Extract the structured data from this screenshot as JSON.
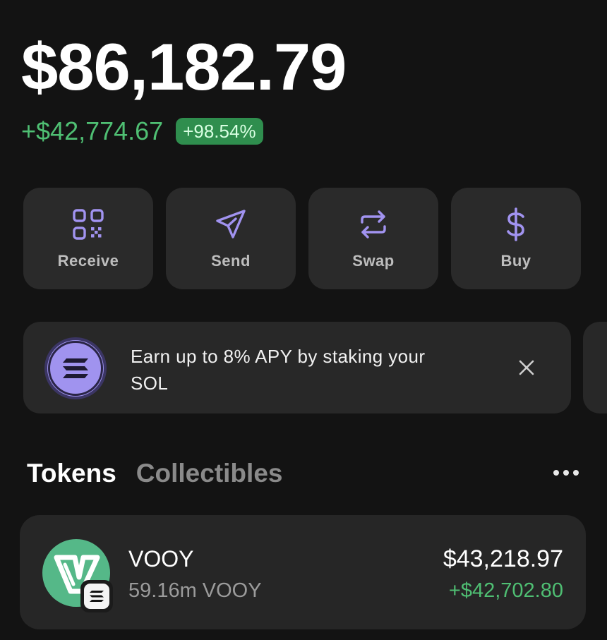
{
  "balance": {
    "total": "$86,182.79",
    "change_amount": "+$42,774.67",
    "change_percent": "+98.54%"
  },
  "colors": {
    "accent": "#a193f0",
    "positive": "#4fbf73",
    "positive_badge": "#2f8e4e",
    "card": "#2a2a2a",
    "background": "#131313"
  },
  "actions": [
    {
      "label": "Receive",
      "icon": "qr-code-icon"
    },
    {
      "label": "Send",
      "icon": "send-icon"
    },
    {
      "label": "Swap",
      "icon": "swap-icon"
    },
    {
      "label": "Buy",
      "icon": "dollar-icon"
    }
  ],
  "promo": {
    "text": "Earn up to 8% APY by staking your SOL",
    "icon": "solana-icon",
    "close_icon": "close-icon"
  },
  "tabs": [
    {
      "label": "Tokens",
      "active": true
    },
    {
      "label": "Collectibles",
      "active": false
    }
  ],
  "more_icon": "more-horizontal-icon",
  "tokens": [
    {
      "name": "VOOY",
      "quantity": "59.16m VOOY",
      "value": "$43,218.97",
      "change": "+$42,702.80",
      "icon": "vooy-logo-icon",
      "chain_icon": "solana-chain-badge-icon"
    }
  ]
}
